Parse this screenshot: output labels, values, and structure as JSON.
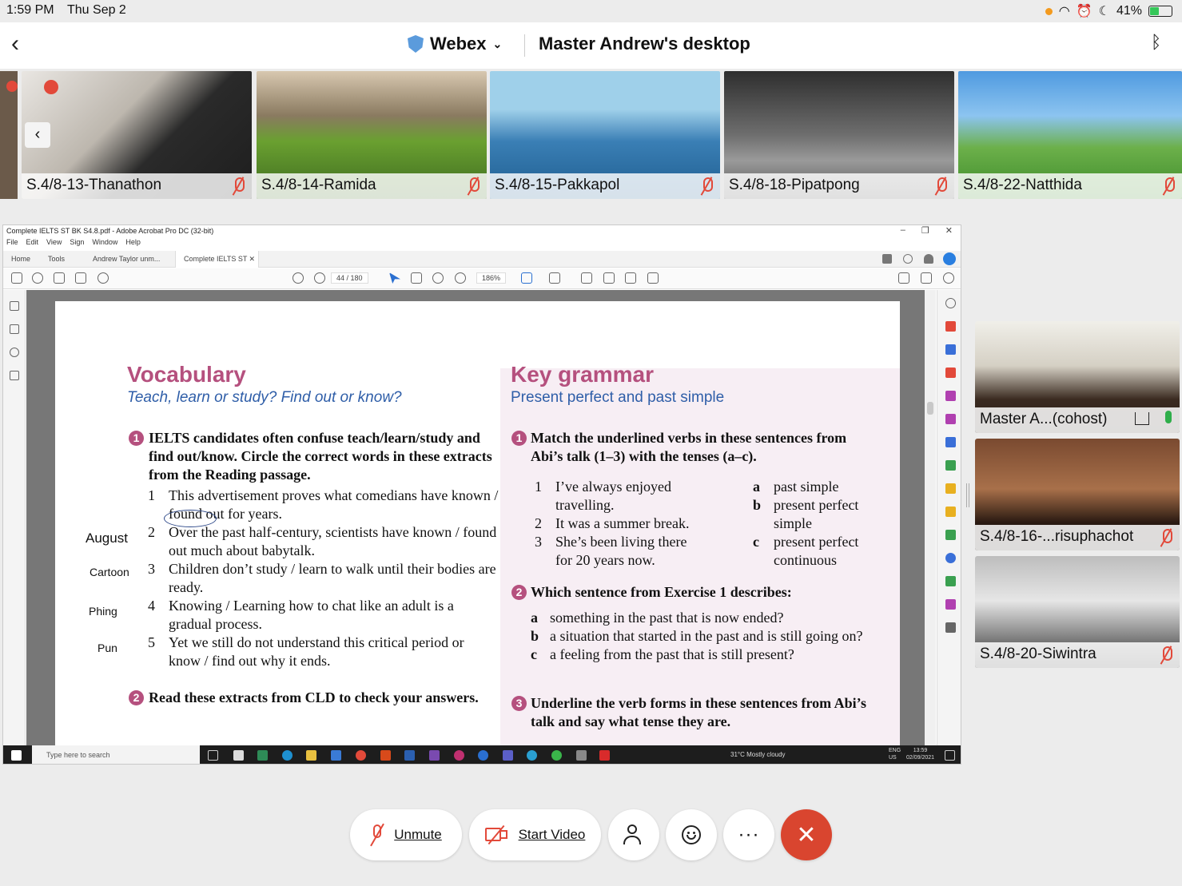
{
  "status_bar": {
    "time": "1:59 PM",
    "date": "Thu Sep 2",
    "battery": "41%"
  },
  "header": {
    "app": "Webex",
    "title": "Master Andrew's desktop"
  },
  "thumbnails": [
    {
      "name": "S.4/8-13-Thanathon"
    },
    {
      "name": "S.4/8-14-Ramida"
    },
    {
      "name": "S.4/8-15-Pakkapol"
    },
    {
      "name": "S.4/8-18-Pipatpong"
    },
    {
      "name": "S.4/8-22-Natthida"
    }
  ],
  "acrobat": {
    "window_title": "Complete IELTS ST BK S4.8.pdf - Adobe Acrobat Pro DC (32-bit)",
    "menu": [
      "File",
      "Edit",
      "View",
      "Sign",
      "Window",
      "Help"
    ],
    "tabs": [
      "Home",
      "Tools",
      "Andrew Taylor unm...",
      "Complete IELTS ST ..."
    ],
    "page_current": "44",
    "page_total": "/ 180",
    "zoom": "186%"
  },
  "book": {
    "vocab_title": "Vocabulary",
    "vocab_subtitle": "Teach, learn or study? Find out or know?",
    "ex1_text": "IELTS candidates often confuse teach/learn/study and find out/know. Circle the correct words in these extracts from the Reading passage.",
    "vocab_items": [
      {
        "n": "1",
        "text": "This advertisement proves what comedians have known / found out for years."
      },
      {
        "n": "2",
        "text": "Over the past half-century, scientists have known / found out much about babytalk."
      },
      {
        "n": "3",
        "text": "Children don’t study / learn to walk until their bodies are ready."
      },
      {
        "n": "4",
        "text": "Knowing / Learning how to chat like an adult is a gradual process."
      },
      {
        "n": "5",
        "text": "Yet we still do not understand this critical period or know / find out why it ends."
      }
    ],
    "ex2_text": "Read these extracts from CLD to check your answers.",
    "margin_names": [
      "August",
      "Cartoon",
      "Phing",
      "Pun"
    ],
    "grammar_title": "Key grammar",
    "grammar_subtitle": "Present perfect and past simple",
    "g1_text": "Match the underlined verbs in these sentences from Abi’s talk (1–3) with the tenses (a–c).",
    "g1_sentences": [
      {
        "n": "1",
        "text": "I’ve always enjoyed travelling."
      },
      {
        "n": "2",
        "text": "It was a summer break."
      },
      {
        "n": "3",
        "text": "She’s been living there for 20 years now."
      }
    ],
    "g1_tenses": [
      {
        "l": "a",
        "text": "past simple"
      },
      {
        "l": "b",
        "text": "present perfect simple"
      },
      {
        "l": "c",
        "text": "present perfect continuous"
      }
    ],
    "g2_text": "Which sentence from Exercise 1 describes:",
    "g2_items": [
      {
        "l": "a",
        "text": "something in the past that is now ended?"
      },
      {
        "l": "b",
        "text": "a situation that started in the past and is still going on?"
      },
      {
        "l": "c",
        "text": "a feeling from the past that is still present?"
      }
    ],
    "g3_text": "Underline the verb forms in these sentences from Abi’s talk and say what tense they are."
  },
  "taskbar": {
    "search": "Type here to search",
    "weather": "31°C  Mostly cloudy",
    "lang": "ENG\nUS",
    "time": "13:59",
    "date": "02/09/2021"
  },
  "right_panel": [
    {
      "name": "Master A...(cohost)"
    },
    {
      "name": "S.4/8-16-...risuphachot"
    },
    {
      "name": "S.4/8-20-Siwintra"
    }
  ],
  "controls": {
    "unmute": "Unmute",
    "start_video": "Start Video",
    "more": "···"
  },
  "colors": {
    "end_call": "#d9452f",
    "heading_pink": "#b5507e",
    "subtitle_blue": "#2f5ea8"
  }
}
